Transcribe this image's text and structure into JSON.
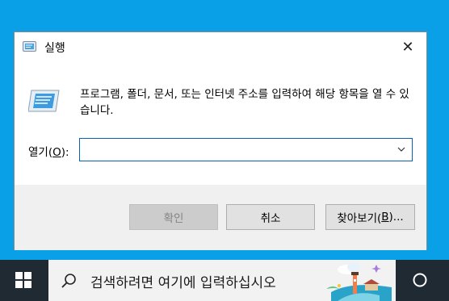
{
  "dialog": {
    "title": "실행",
    "close_glyph": "✕",
    "description": "프로그램, 폴더, 문서, 또는 인터넷 주소를 입력하여 해당 항목을 열 수 있습니다.",
    "open_label_prefix": "열기(",
    "open_label_access": "O",
    "open_label_suffix": "):",
    "open_value": "",
    "buttons": {
      "ok": "확인",
      "cancel": "취소",
      "browse_prefix": "찾아보기(",
      "browse_access": "B",
      "browse_suffix": ")..."
    }
  },
  "taskbar": {
    "search_placeholder": "검색하려면 여기에 입력하십시오",
    "icons": [
      "windows-start-icon",
      "search-icon",
      "cortana-circle-icon"
    ]
  },
  "colors": {
    "desktop": "#0aa0e8",
    "taskbar": "#1f2a33",
    "accent_border": "#0a60b8"
  }
}
